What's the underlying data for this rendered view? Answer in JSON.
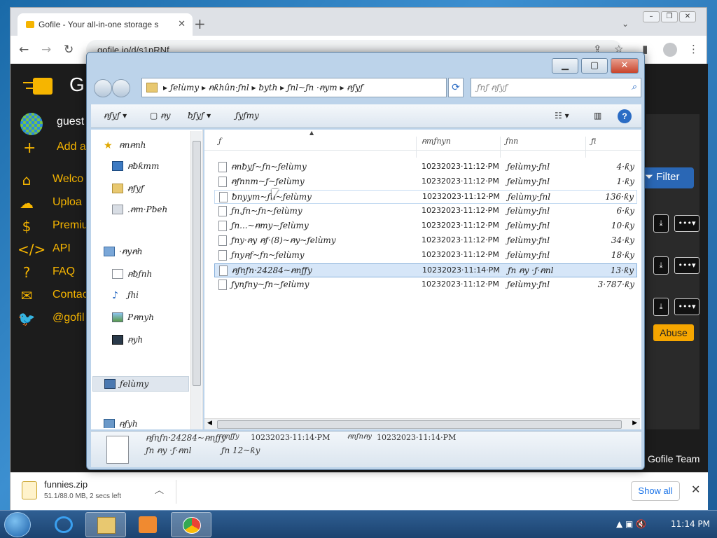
{
  "browser": {
    "tab_title": "Gofile - Your all-in-one storage s",
    "address": "gofile.io/d/s1nRNf"
  },
  "site": {
    "brand": "G",
    "user": "guest",
    "add_label": "Add a",
    "menu": [
      {
        "label": "Welco",
        "icon": "home-icon"
      },
      {
        "label": "Uploa",
        "icon": "upload-icon"
      },
      {
        "label": "Premiu",
        "icon": "dollar-icon"
      },
      {
        "label": "API",
        "icon": "code-icon"
      },
      {
        "label": "FAQ",
        "icon": "question-icon"
      },
      {
        "label": "Contac",
        "icon": "mail-icon"
      },
      {
        "label": "@gofil",
        "icon": "twitter-icon"
      }
    ],
    "filter_label": "Filter",
    "abuse_label": "Abuse",
    "footer": "Gofile Team"
  },
  "download": {
    "filename": "funnies.zip",
    "progress": "51.1/88.0 MB, 2 secs left",
    "show_all": "Show all"
  },
  "dialog": {
    "breadcrumb": [
      "ƒelùmy",
      "ꞥƙhûn·ƒnl",
      "ƀyth",
      "ƒnl~ƒn ·ꞥym",
      "ꞥƒyƒ"
    ],
    "search_placeholder": "ƒnƒ ꞥƒyƒ",
    "commands": [
      "ꞥƒyƒ",
      "ꞥy",
      "ƀƒyƒ",
      "ƒyƒmy"
    ],
    "nav": [
      {
        "label": "ꞥnꞥnh",
        "icon": "star-icon"
      },
      {
        "label": "ꞥƀƙmm",
        "icon": "desktop-icon"
      },
      {
        "label": "ꞥƒyƒ",
        "icon": "downloads-icon"
      },
      {
        "label": ".ꞥm·Pƀeh",
        "icon": "recent-places-icon"
      },
      {
        "label": "·ꞥyꞥh",
        "icon": "library-icon"
      },
      {
        "label": "ꞥƀƒnh",
        "icon": "documents-icon"
      },
      {
        "label": "ƒhi",
        "icon": "music-icon"
      },
      {
        "label": "Pꞥnyh",
        "icon": "pictures-icon"
      },
      {
        "label": "ꞥyh",
        "icon": "videos-icon"
      },
      {
        "label": "ƒelùmy",
        "icon": "computer-icon"
      },
      {
        "label": "ꞥƒyh",
        "icon": "network-icon"
      }
    ],
    "columns": [
      "ƒ",
      "ꞥmƒnyn",
      "ƒnn",
      "ƒi"
    ],
    "files": [
      {
        "name": "ꞥnƀyƒ~ƒn~ƒelùmy",
        "date": "10232023·11:12·PM",
        "type": "ƒelùmy·ƒnl",
        "size": "4·ƙy"
      },
      {
        "name": "ꞥƒnnm~ƒ~ƒelùmy",
        "date": "10232023·11:12·PM",
        "type": "ƒelùmy·ƒnl",
        "size": "1·ƙy"
      },
      {
        "name": "ƀnyym~ƒn~ƒelùmy",
        "date": "10232023·11:12·PM",
        "type": "ƒelùmy·ƒnl",
        "size": "136·ƙy"
      },
      {
        "name": "ƒn.ƒn~ƒn~ƒelùmy",
        "date": "10232023·11:12·PM",
        "type": "ƒelùmy·ƒnl",
        "size": "6·ƙy"
      },
      {
        "name": "ƒn...~ꞥmy~ƒelùmy",
        "date": "10232023·11:12·PM",
        "type": "ƒelùmy·ƒnl",
        "size": "10·ƙy"
      },
      {
        "name": "ƒny·ꞥy ꞥƒ·(8)~ꞥy~ƒelùmy",
        "date": "10232023·11:12·PM",
        "type": "ƒelùmy·ƒnl",
        "size": "34·ƙy"
      },
      {
        "name": "ƒnyꞥƒ~ƒn~ƒelùmy",
        "date": "10232023·11:12·PM",
        "type": "ƒelùmy·ƒnl",
        "size": "18·ƙy"
      },
      {
        "name": "ꞥƒnƒn·24284~ꞥnƒƒy",
        "date": "10232023·11:14·PM",
        "type": "ƒn ꞥy ·ƒ·ꞥnl",
        "size": "13·ƙy"
      },
      {
        "name": "ƒynƒny~ƒn~ƒelùmy",
        "date": "10232023·11:12·PM",
        "type": "ƒelùmy·ƒnl",
        "size": "3·787·ƙy"
      }
    ],
    "details": {
      "name": "ꞥƒnƒn·24284~ꞥnƒƒy",
      "modified_label": "ꞥnƒƒy",
      "modified": "10232023·11:14·PM",
      "created_label": "ꞥnƒnꞥy",
      "created": "10232023·11:14·PM",
      "type": "ƒn ꞥy ·ƒ·ꞥnl",
      "size": "ƒn 12~ƙy"
    }
  },
  "taskbar": {
    "clock": "11:14 PM"
  }
}
